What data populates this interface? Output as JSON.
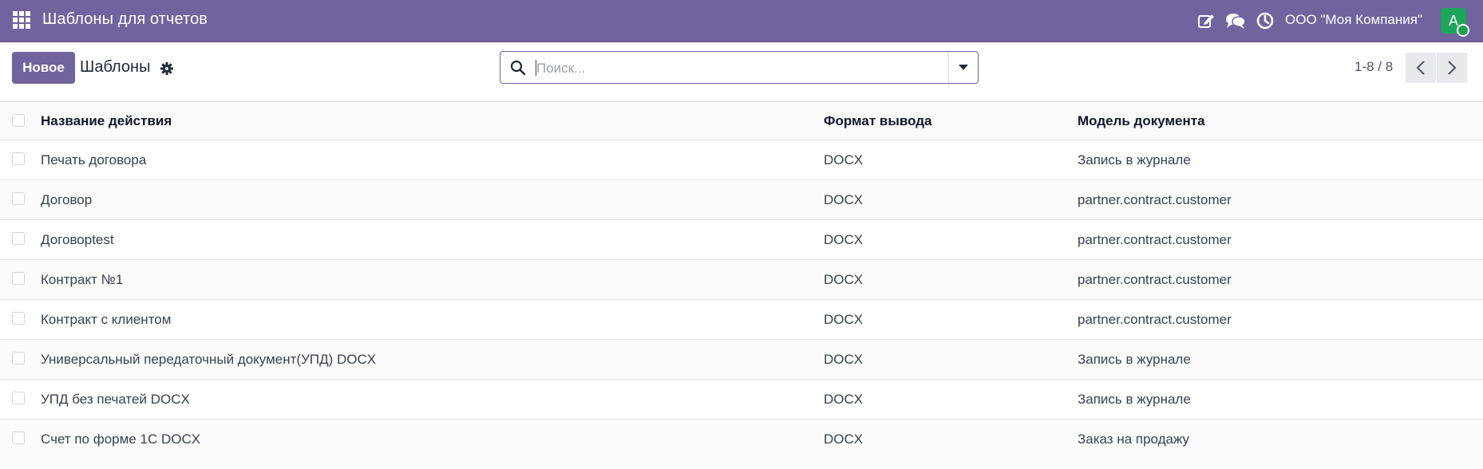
{
  "navbar": {
    "app_title": "Шаблоны для отчетов",
    "company": "ООО \"Моя Компания\"",
    "avatar_letter": "A",
    "brand_color": "#71639e",
    "icons": [
      "apps-grid-icon",
      "edit-icon",
      "chat-icon",
      "clock-icon"
    ]
  },
  "control": {
    "new_label": "Новое",
    "title": "Шаблоны",
    "search_placeholder": "Поиск...",
    "pager": "1-8 / 8"
  },
  "table": {
    "columns": [
      "Название действия",
      "Формат вывода",
      "Модель документа"
    ],
    "rows": [
      {
        "name": "Печать договора",
        "format": "DOCX",
        "model": "Запись в журнале"
      },
      {
        "name": "Договор",
        "format": "DOCX",
        "model": "partner.contract.customer"
      },
      {
        "name": "Договорtest",
        "format": "DOCX",
        "model": "partner.contract.customer"
      },
      {
        "name": "Контракт №1",
        "format": "DOCX",
        "model": "partner.contract.customer"
      },
      {
        "name": "Контракт с клиентом",
        "format": "DOCX",
        "model": "partner.contract.customer"
      },
      {
        "name": "Универсальный передаточный документ(УПД) DOCX",
        "format": "DOCX",
        "model": "Запись в журнале"
      },
      {
        "name": "УПД без печатей DOCX",
        "format": "DOCX",
        "model": "Запись в журнале"
      },
      {
        "name": "Счет по форме 1С DOCX",
        "format": "DOCX",
        "model": "Заказ на продажу"
      }
    ]
  }
}
